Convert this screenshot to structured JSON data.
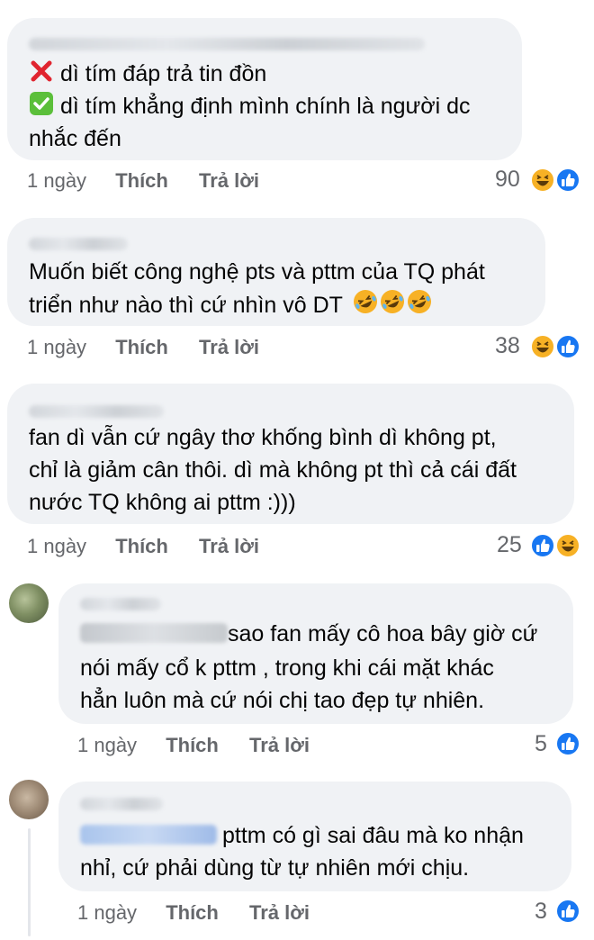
{
  "comments": [
    {
      "lines": [
        "dì tím đáp trả tin đồn",
        "dì tím khẳng định mình chính là người dc",
        "nhắc đến"
      ],
      "time": "1 ngày",
      "like": "Thích",
      "reply": "Trả lời",
      "count": "90",
      "reactions": [
        "haha-icon",
        "like-icon"
      ]
    },
    {
      "lines": [
        "Muốn biết công nghệ pts và pttm của TQ phát",
        "triển như nào thì cứ nhìn vô DT"
      ],
      "time": "1 ngày",
      "like": "Thích",
      "reply": "Trả lời",
      "count": "38",
      "reactions": [
        "haha-icon",
        "like-icon"
      ]
    },
    {
      "lines": [
        "fan dì vẫn cứ ngây thơ khống bình dì không pt,",
        "chỉ là giảm cân thôi. dì mà không pt thì cả cái đất",
        "nước TQ không ai pttm :)))"
      ],
      "time": "1 ngày",
      "like": "Thích",
      "reply": "Trả lời",
      "count": "25",
      "reactions": [
        "like-icon",
        "haha-icon"
      ]
    },
    {
      "lines": [
        "sao fan mấy cô hoa bây giờ cứ",
        "nói mấy cổ k pttm , trong khi cái mặt khác",
        "hẳn luôn mà cứ nói chị tao đẹp tự nhiên."
      ],
      "time": "1 ngày",
      "like": "Thích",
      "reply": "Trả lời",
      "count": "5",
      "reactions": [
        "like-icon"
      ]
    },
    {
      "lines": [
        "pttm có gì sai đâu mà ko nhận",
        "nhỉ, cứ phải dùng từ tự nhiên mới chịu."
      ],
      "time": "1 ngày",
      "like": "Thích",
      "reply": "Trả lời",
      "count": "3",
      "reactions": [
        "like-icon"
      ]
    }
  ],
  "colors": {
    "bubble": "#f0f2f5",
    "meta": "#65676b",
    "like_blue": "#1877f2",
    "haha_yellow": "#f7b125"
  }
}
